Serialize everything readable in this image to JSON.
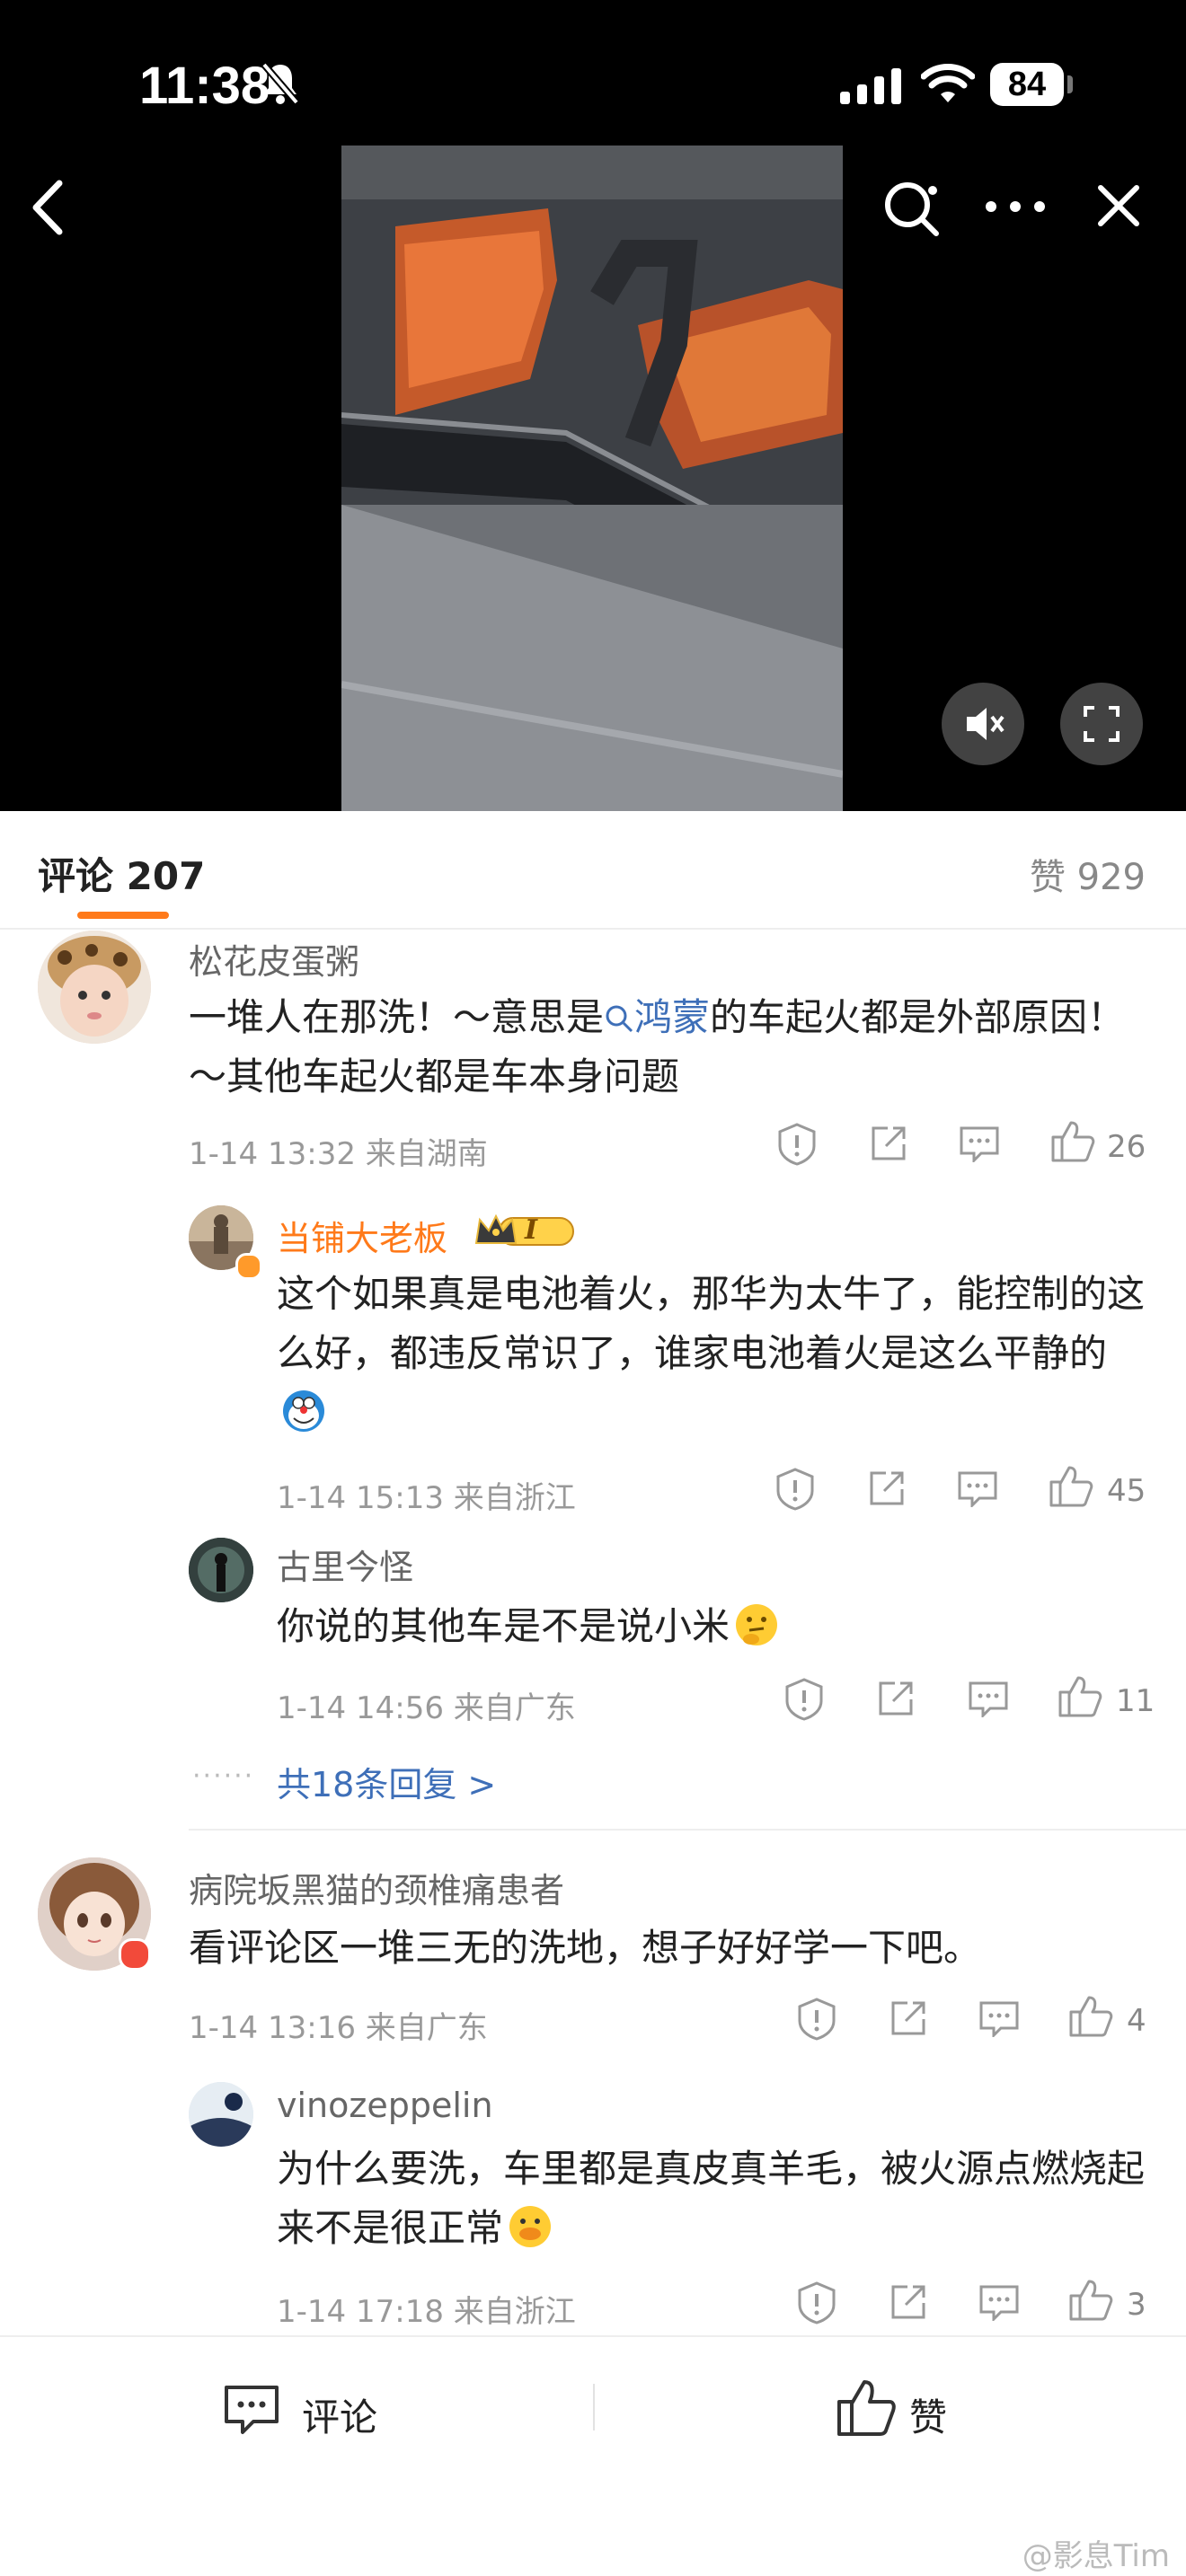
{
  "status_bar": {
    "time": "11:38",
    "battery": "84"
  },
  "video": {},
  "comments_header": {
    "title": "评论 207",
    "likes": "赞 929"
  },
  "comments": [
    {
      "user": "松花皮蛋粥",
      "text_before": "一堆人在那洗！～意思是",
      "topic": "鸿蒙",
      "text_after": "的车起火都是外部原因！～其他车起火都是车本身问题",
      "time": "1-14 13:32",
      "location": "来自湖南",
      "likes": "26"
    },
    {
      "user": "病院坂黑猫的颈椎痛患者",
      "text": "看评论区一堆三无的洗地，想子好好学一下吧。",
      "time": "1-14 13:16",
      "location": "来自广东",
      "likes": "4"
    }
  ],
  "replies": [
    {
      "user": "当铺大老板",
      "badge": "I",
      "text": "这个如果真是电池着火，那华为太牛了，能控制的这么好，都违反常识了，谁家电池着火是这么平静的",
      "time": "1-14 15:13",
      "location": "来自浙江",
      "likes": "45"
    },
    {
      "user": "古里今怪",
      "text": "你说的其他车是不是说小米",
      "time": "1-14 14:56",
      "location": "来自广东",
      "likes": "11"
    },
    {
      "user": "vinozeppelin",
      "text": "为什么要洗，车里都是真皮真羊毛，被火源点燃烧起来不是很正常",
      "time": "1-14 17:18",
      "location": "来自浙江",
      "likes": "3"
    }
  ],
  "more_replies": "共18条回复 >",
  "bottom_bar": {
    "comment_label": "评论",
    "like_label": "赞"
  },
  "watermark": "@影息Tim"
}
